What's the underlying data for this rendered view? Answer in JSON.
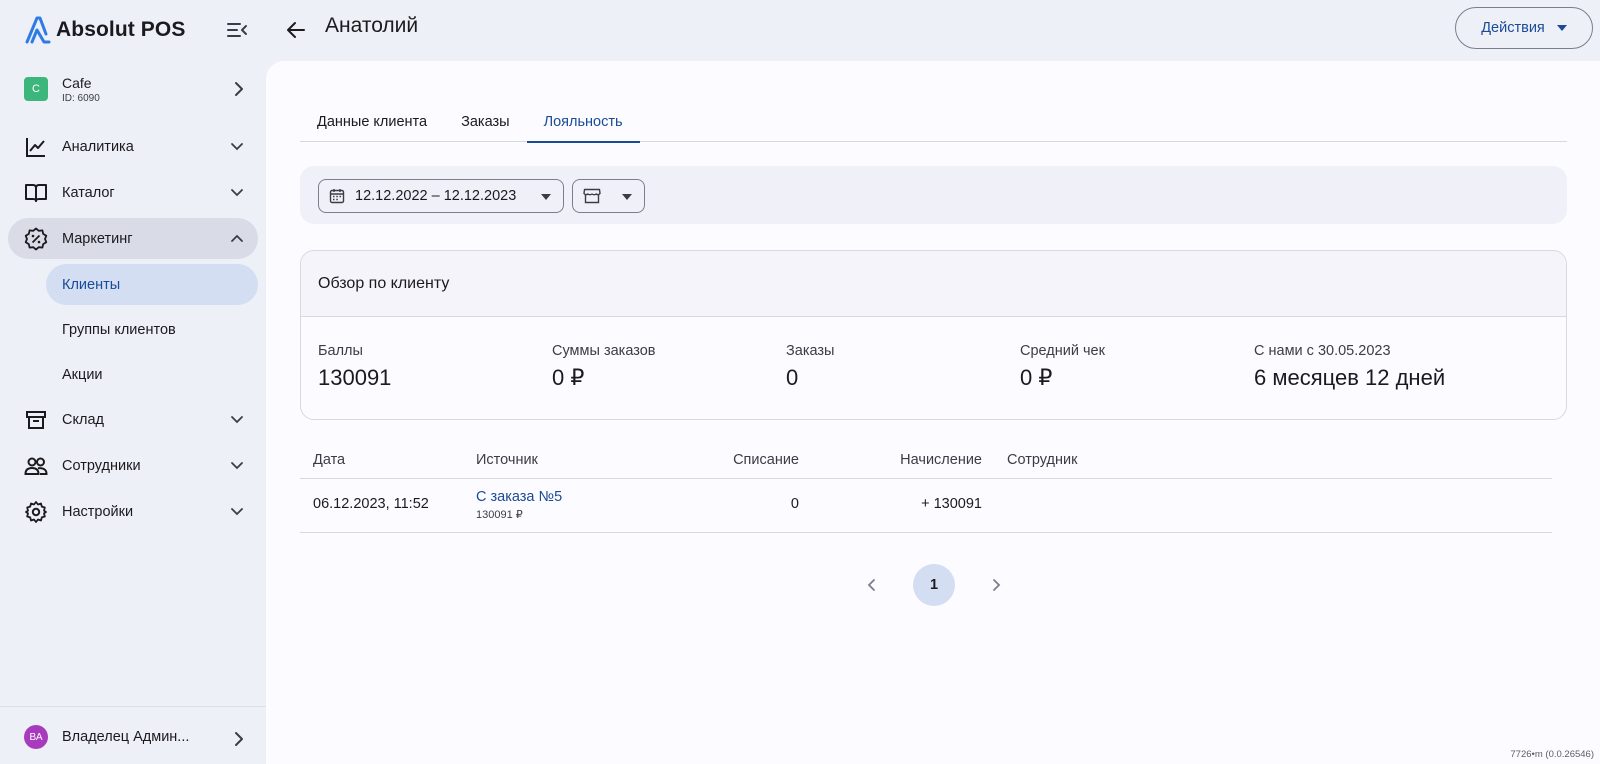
{
  "app": {
    "name": "Absolut POS"
  },
  "store": {
    "badge": "C",
    "name": "Cafe",
    "id": "ID: 6090"
  },
  "nav": {
    "analytics": "Аналитика",
    "catalog": "Каталог",
    "marketing": "Маркетинг",
    "marketing_sub": [
      "Клиенты",
      "Группы клиентов",
      "Акции"
    ],
    "warehouse": "Склад",
    "staff": "Сотрудники",
    "settings": "Настройки"
  },
  "user": {
    "initials": "ВА",
    "name": "Владелец Админ..."
  },
  "header": {
    "title": "Анатолий",
    "actions_label": "Действия"
  },
  "tabs": [
    "Данные клиента",
    "Заказы",
    "Лояльность"
  ],
  "active_tab": "Лояльность",
  "filters": {
    "date_range": "12.12.2022 – 12.12.2023"
  },
  "overview": {
    "title": "Обзор по клиенту",
    "stats": [
      {
        "label": "Баллы",
        "value": "130091"
      },
      {
        "label": "Суммы заказов",
        "value": "0 ₽"
      },
      {
        "label": "Заказы",
        "value": "0"
      },
      {
        "label": "Средний чек",
        "value": "0 ₽"
      },
      {
        "label": "С нами с 30.05.2023",
        "value": "6 месяцев 12 дней"
      }
    ]
  },
  "table": {
    "columns": [
      "Дата",
      "Источник",
      "Списание",
      "Начисление",
      "Сотрудник"
    ],
    "rows": [
      {
        "date": "06.12.2023, 11:52",
        "source": "С заказа №5",
        "source_sub": "130091 ₽",
        "writeoff": "0",
        "accrual": "+ 130091",
        "employee": ""
      }
    ]
  },
  "pagination": {
    "current": "1"
  },
  "build": "7726•m (0.0.26546)",
  "colors": {
    "accent": "#1a4b96",
    "active_bg": "#d3def2",
    "store_badge": "#3db67b",
    "avatar": "#a83bbd"
  }
}
